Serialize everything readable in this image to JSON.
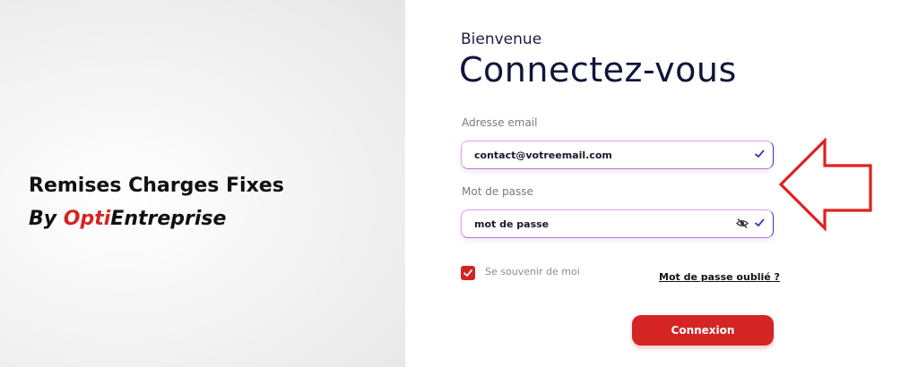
{
  "brand": {
    "title": "Remises Charges Fixes",
    "by": "By ",
    "accent": "Opti",
    "rest": "Entreprise",
    "accent_color": "#d42424"
  },
  "login": {
    "welcome": "Bienvenue",
    "heading": "Connectez-vous",
    "email_label": "Adresse email",
    "email_value": "contact@votreemail.com",
    "password_label": "Mot de passe",
    "password_value": "mot de passe",
    "remember_label": "Se souvenir de moi",
    "remember_checked": true,
    "forgot_link": "Mot de passe oublié ?",
    "submit_label": "Connexion"
  },
  "icons": {
    "field_valid": "check-icon",
    "password_visibility": "eye-slash-icon",
    "annotation": "arrow-left-icon"
  },
  "colors": {
    "accent": "#d42424",
    "heading": "#10163a",
    "check": "#3d35b8"
  }
}
